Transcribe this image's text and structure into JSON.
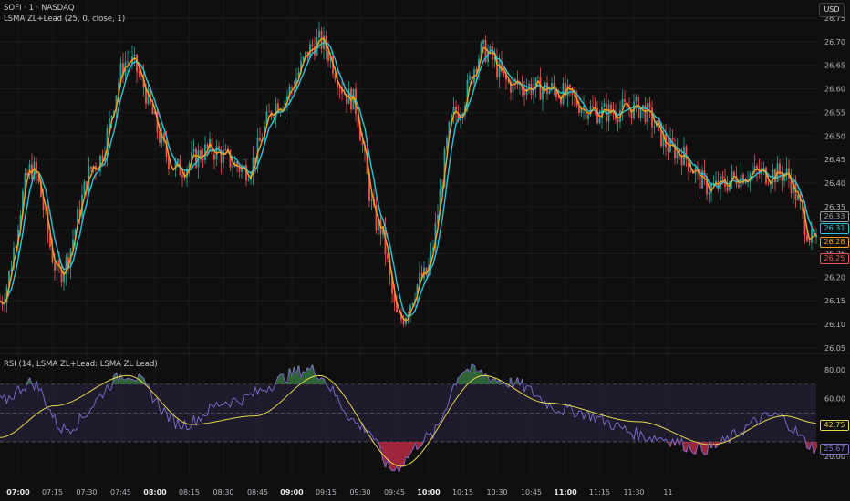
{
  "header": {
    "symbol": "SOFI · 1 · NASDAQ",
    "indicator": "LSMA ZL+Lead (25, 0, close, 1)",
    "currency": "USD"
  },
  "rsi_header": {
    "label": "RSI (14, LSMA ZL+Lead: LSMA ZL Lead)"
  },
  "colors": {
    "up": "#26a69a",
    "down": "#ef5350",
    "lead": "#f7a21b",
    "zl": "#26c6da",
    "rsi": "#7e6fd1",
    "signal": "#e6d84a",
    "band": "#2a2240"
  },
  "price_labels": [
    {
      "value": "26.33",
      "color": "#9a9a9a"
    },
    {
      "value": "26.31",
      "color": "#26c6da"
    },
    {
      "value": "26.28",
      "color": "#f7a21b"
    },
    {
      "value": "26.25",
      "color": "#ef5350"
    }
  ],
  "rsi_labels": [
    {
      "value": "42.75",
      "color": "#e6d84a"
    },
    {
      "value": "25.67",
      "color": "#7e6fd1"
    }
  ],
  "chart_data": {
    "type": "candlestick",
    "title": "SOFI · 1 · NASDAQ",
    "y_ticks": [
      "26.75",
      "26.70",
      "26.65",
      "26.60",
      "26.55",
      "26.50",
      "26.45",
      "26.40",
      "26.35",
      "26.30",
      "26.25",
      "26.20",
      "26.15",
      "26.10",
      "26.05"
    ],
    "ylim": [
      26.05,
      26.75
    ],
    "x_ticks": [
      {
        "label": "07:00",
        "bold": true
      },
      {
        "label": "07:15"
      },
      {
        "label": "07:30"
      },
      {
        "label": "07:45"
      },
      {
        "label": "08:00",
        "bold": true
      },
      {
        "label": "08:15"
      },
      {
        "label": "08:30"
      },
      {
        "label": "08:45"
      },
      {
        "label": "09:00",
        "bold": true
      },
      {
        "label": "09:15"
      },
      {
        "label": "09:30"
      },
      {
        "label": "09:45"
      },
      {
        "label": "10:00",
        "bold": true
      },
      {
        "label": "10:15"
      },
      {
        "label": "10:30"
      },
      {
        "label": "10:45"
      },
      {
        "label": "11:00",
        "bold": true
      },
      {
        "label": "11:15"
      },
      {
        "label": "11:30"
      },
      {
        "label": "11"
      }
    ],
    "price_keypoints_minutes_from_0700": [
      [
        -8,
        26.15
      ],
      [
        6,
        26.43
      ],
      [
        18,
        26.21
      ],
      [
        34,
        26.44
      ],
      [
        48,
        26.66
      ],
      [
        70,
        26.43
      ],
      [
        84,
        26.47
      ],
      [
        100,
        26.43
      ],
      [
        114,
        26.57
      ],
      [
        132,
        26.7
      ],
      [
        146,
        26.58
      ],
      [
        158,
        26.31
      ],
      [
        167,
        26.11
      ],
      [
        178,
        26.2
      ],
      [
        192,
        26.55
      ],
      [
        204,
        26.68
      ],
      [
        216,
        26.61
      ],
      [
        232,
        26.6
      ],
      [
        256,
        26.55
      ],
      [
        272,
        26.56
      ],
      [
        288,
        26.47
      ],
      [
        304,
        26.39
      ],
      [
        320,
        26.42
      ],
      [
        336,
        26.42
      ],
      [
        350,
        26.27
      ]
    ],
    "rsi": {
      "ylim": [
        20,
        80
      ],
      "y_ticks": [
        "80.00",
        "60.00",
        "20.00"
      ],
      "bands": [
        30,
        50,
        70
      ],
      "rsi_keypoints": [
        [
          -8,
          58
        ],
        [
          6,
          71
        ],
        [
          20,
          39
        ],
        [
          48,
          77
        ],
        [
          72,
          42
        ],
        [
          92,
          58
        ],
        [
          128,
          80
        ],
        [
          152,
          40
        ],
        [
          164,
          11
        ],
        [
          180,
          33
        ],
        [
          196,
          80
        ],
        [
          216,
          71
        ],
        [
          240,
          52
        ],
        [
          280,
          33
        ],
        [
          300,
          25
        ],
        [
          332,
          48
        ],
        [
          350,
          26
        ]
      ],
      "signal_keypoints": [
        [
          -8,
          33
        ],
        [
          16,
          55
        ],
        [
          48,
          76
        ],
        [
          76,
          42
        ],
        [
          104,
          48
        ],
        [
          132,
          76
        ],
        [
          168,
          13
        ],
        [
          204,
          76
        ],
        [
          232,
          57
        ],
        [
          272,
          44
        ],
        [
          304,
          28
        ],
        [
          336,
          48
        ],
        [
          350,
          43
        ]
      ]
    }
  }
}
